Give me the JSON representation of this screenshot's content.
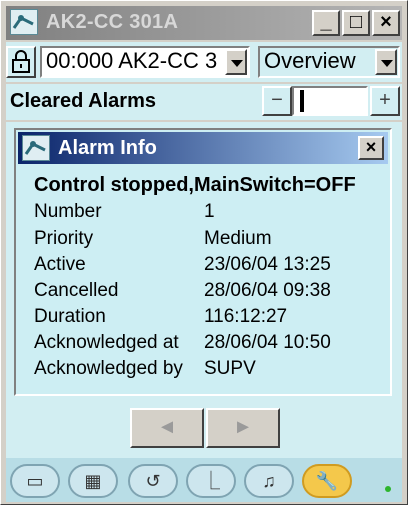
{
  "window": {
    "title": "AK2-CC 301A",
    "minimize_label": "_",
    "maximize_label": "□",
    "close_label": "×"
  },
  "controls": {
    "device_select": "00:000 AK2-CC 3",
    "view_select": "Overview",
    "section_label": "Cleared Alarms",
    "spin_prev": "−",
    "spin_next": "+"
  },
  "alarm_info": {
    "window_title": "Alarm Info",
    "close_label": "×",
    "heading": "Control stopped,MainSwitch=OFF",
    "fields": [
      {
        "label": "Number",
        "value": "1"
      },
      {
        "label": "Priority",
        "value": "Medium"
      },
      {
        "label": "Active",
        "value": "23/06/04 13:25"
      },
      {
        "label": "Cancelled",
        "value": "28/06/04 09:38"
      },
      {
        "label": "Duration",
        "value": "116:12:27"
      },
      {
        "label": "Acknowledged at",
        "value": "28/06/04 10:50"
      },
      {
        "label": "Acknowledged by",
        "value": "SUPV"
      }
    ]
  },
  "nav": {
    "prev_label": "◄",
    "next_label": "►"
  },
  "toolbar": {
    "buttons": [
      {
        "icon": "device-icon",
        "glyph": "▭"
      },
      {
        "icon": "grid-icon",
        "glyph": "▦"
      },
      {
        "icon": "refresh-icon",
        "glyph": "↺"
      },
      {
        "icon": "graph-icon",
        "glyph": "⎿"
      },
      {
        "icon": "bell-icon",
        "glyph": "♫"
      },
      {
        "icon": "wrench-icon",
        "glyph": "🔧"
      }
    ],
    "status_color": "#2db52d"
  }
}
